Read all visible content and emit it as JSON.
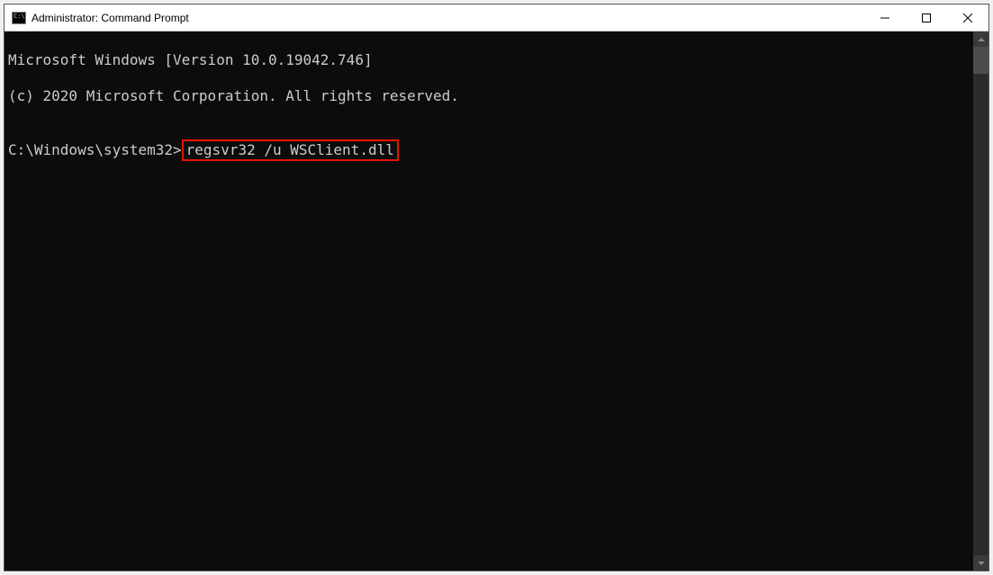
{
  "window": {
    "title": "Administrator: Command Prompt"
  },
  "terminal": {
    "line1": "Microsoft Windows [Version 10.0.19042.746]",
    "line2": "(c) 2020 Microsoft Corporation. All rights reserved.",
    "blank": "",
    "prompt": "C:\\Windows\\system32>",
    "command": "regsvr32 /u WSClient.dll"
  },
  "icons": {
    "cmd": "cmd-icon",
    "minimize": "minimize-icon",
    "maximize": "maximize-icon",
    "close": "close-icon",
    "scrollup": "scroll-up-icon",
    "scrolldown": "scroll-down-icon"
  }
}
